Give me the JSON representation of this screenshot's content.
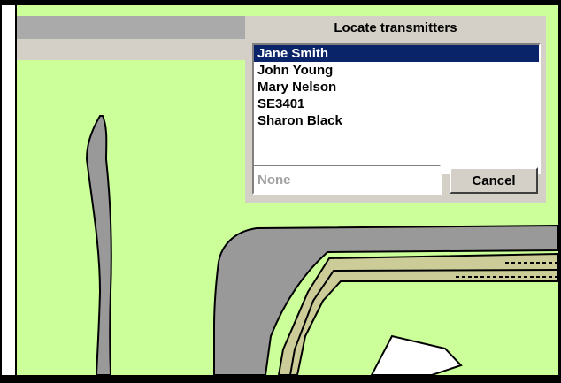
{
  "dialog": {
    "title": "Locate transmitters",
    "transmitters": [
      {
        "name": "Jane Smith",
        "selected": true
      },
      {
        "name": "John Young",
        "selected": false
      },
      {
        "name": "Mary Nelson",
        "selected": false
      },
      {
        "name": "SE3401",
        "selected": false
      },
      {
        "name": "Sharon Black",
        "selected": false
      }
    ],
    "search_placeholder": "None",
    "search_value": "",
    "cancel_label": "Cancel"
  },
  "colors": {
    "map_background": "#ccff99",
    "road": "#999999",
    "track": "#cccc99",
    "toolbar": "#aaaaaa",
    "selection": "#0a246a"
  }
}
